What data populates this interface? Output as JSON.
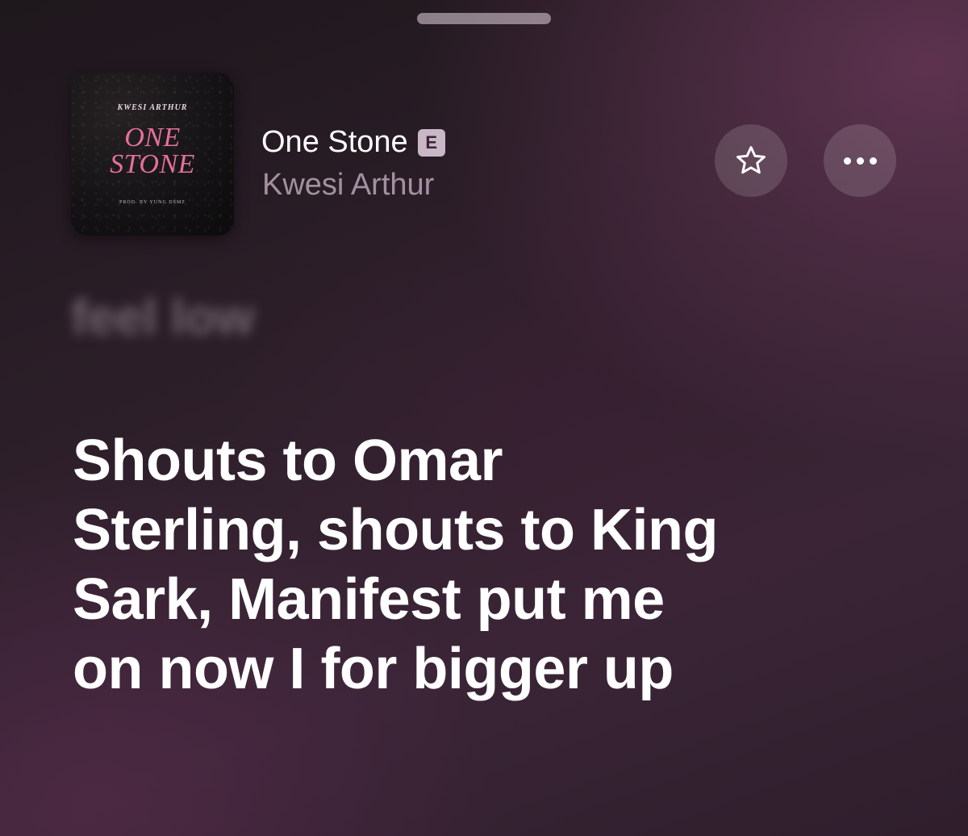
{
  "player": {
    "song_title": "One Stone",
    "explicit_badge": "E",
    "artist": "Kwesi Arthur",
    "artwork": {
      "artist_text": "KWESI ARTHUR",
      "title_text": "ONE STONE",
      "credit_text": "PROD. BY YUNG DSMZ",
      "icon": "album-artwork"
    },
    "actions": {
      "favorite_icon": "star-icon",
      "more_icon": "ellipsis-icon"
    }
  },
  "lyrics": {
    "previous_line": "feel low",
    "current_lines": [
      "Shouts to Omar",
      "Sterling, shouts to King",
      "Sark, Manifest put me",
      "on now I for bigger up"
    ]
  },
  "colors": {
    "background": "#2b1e28",
    "accent_pink": "#e6709d",
    "badge": "#c9b7c5"
  }
}
